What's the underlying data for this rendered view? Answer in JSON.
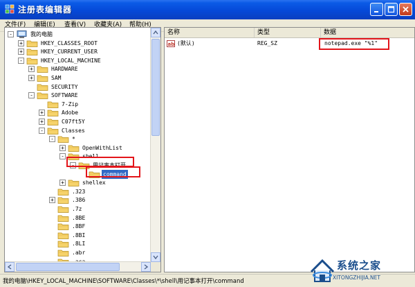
{
  "window": {
    "title": "注册表编辑器"
  },
  "menu": [
    "文件(F)",
    "编辑(E)",
    "查看(V)",
    "收藏夹(A)",
    "帮助(H)"
  ],
  "tree": [
    {
      "label": "我的电脑",
      "expander": "-",
      "folder": "computer",
      "indent": 0
    },
    {
      "label": "HKEY_CLASSES_ROOT",
      "expander": "+",
      "indent": 1
    },
    {
      "label": "HKEY_CURRENT_USER",
      "expander": "+",
      "indent": 1
    },
    {
      "label": "HKEY_LOCAL_MACHINE",
      "expander": "-",
      "indent": 1
    },
    {
      "label": "HARDWARE",
      "expander": "+",
      "indent": 2
    },
    {
      "label": "SAM",
      "expander": "+",
      "indent": 2
    },
    {
      "label": "SECURITY",
      "expander": "",
      "indent": 2
    },
    {
      "label": "SOFTWARE",
      "expander": "-",
      "indent": 2
    },
    {
      "label": "7-Zip",
      "expander": "",
      "indent": 3
    },
    {
      "label": "Adobe",
      "expander": "+",
      "indent": 3
    },
    {
      "label": "C07ft5Y",
      "expander": "+",
      "indent": 3
    },
    {
      "label": "Classes",
      "expander": "-",
      "indent": 3
    },
    {
      "label": "*",
      "expander": "-",
      "indent": 4
    },
    {
      "label": "OpenWithList",
      "expander": "+",
      "indent": 5
    },
    {
      "label": "shell",
      "expander": "-",
      "indent": 5
    },
    {
      "label": "用记事本打开",
      "expander": "-",
      "indent": 6
    },
    {
      "label": "command",
      "expander": "",
      "indent": 7,
      "selected": true
    },
    {
      "label": "shellex",
      "expander": "+",
      "indent": 5
    },
    {
      "label": ".323",
      "expander": "",
      "indent": 4
    },
    {
      "label": ".386",
      "expander": "+",
      "indent": 4
    },
    {
      "label": ".7z",
      "expander": "",
      "indent": 4
    },
    {
      "label": ".8BE",
      "expander": "",
      "indent": 4
    },
    {
      "label": ".8BF",
      "expander": "",
      "indent": 4
    },
    {
      "label": ".8BI",
      "expander": "",
      "indent": 4
    },
    {
      "label": ".8LI",
      "expander": "",
      "indent": 4
    },
    {
      "label": ".abr",
      "expander": "",
      "indent": 4
    },
    {
      "label": ".aca",
      "expander": "",
      "indent": 4
    }
  ],
  "list": {
    "columns": [
      "名称",
      "类型",
      "数据"
    ],
    "rows": [
      {
        "name": "(默认)",
        "type": "REG_SZ",
        "data": "notepad.exe \"%1\"",
        "icon": "string-value-icon"
      }
    ]
  },
  "status_bar": "我的电脑\\HKEY_LOCAL_MACHINE\\SOFTWARE\\Classes\\*\\shell\\用记事本打开\\command",
  "watermark": {
    "title": "系统之家",
    "url": "XITONGZHIJIA.NET"
  },
  "colors": {
    "titlebar": "#0549d8",
    "selection": "#316ac5",
    "highlight_box": "#e3151a",
    "folder": "#f6d36b"
  }
}
